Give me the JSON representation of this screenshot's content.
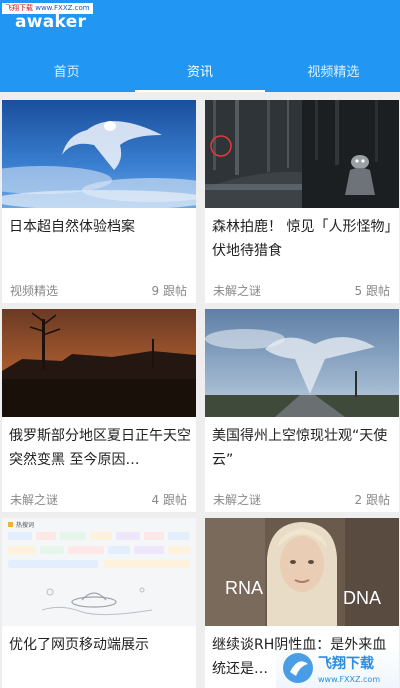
{
  "watermark": {
    "prefix": "飞翔下载",
    "url": "www.FXXZ.com"
  },
  "app": {
    "title": "awaker"
  },
  "tabs": [
    {
      "label": "首页"
    },
    {
      "label": "资讯"
    },
    {
      "label": "视频精选"
    }
  ],
  "active_tab": 1,
  "articles": [
    {
      "title": "日本超自然体验档案",
      "category": "视频精选",
      "comments": "9 跟帖"
    },
    {
      "title": "森林拍鹿！ 惊见「人形怪物」伏地待猎食",
      "category": "未解之谜",
      "comments": "5 跟帖"
    },
    {
      "title": "俄罗斯部分地区夏日正午天空突然变黑 至今原因…",
      "category": "未解之谜",
      "comments": "4 跟帖"
    },
    {
      "title": "美国得州上空惊现壮观“天使云”",
      "category": "未解之谜",
      "comments": "2 跟帖"
    },
    {
      "title": "优化了网页移动端展示"
    },
    {
      "title": "继续谈RH阴性血：是外来血统还是…"
    }
  ],
  "image_labels": {
    "rna": "RNA",
    "dna": "DNA",
    "tag_panel_title": "热搜词"
  },
  "site_logo": {
    "name": "飞翔下载",
    "url": "www.FXXZ.com"
  },
  "colors": {
    "appbar": "#2196f3",
    "background": "#eeeeee",
    "card": "#ffffff",
    "meta_text": "#888888"
  }
}
